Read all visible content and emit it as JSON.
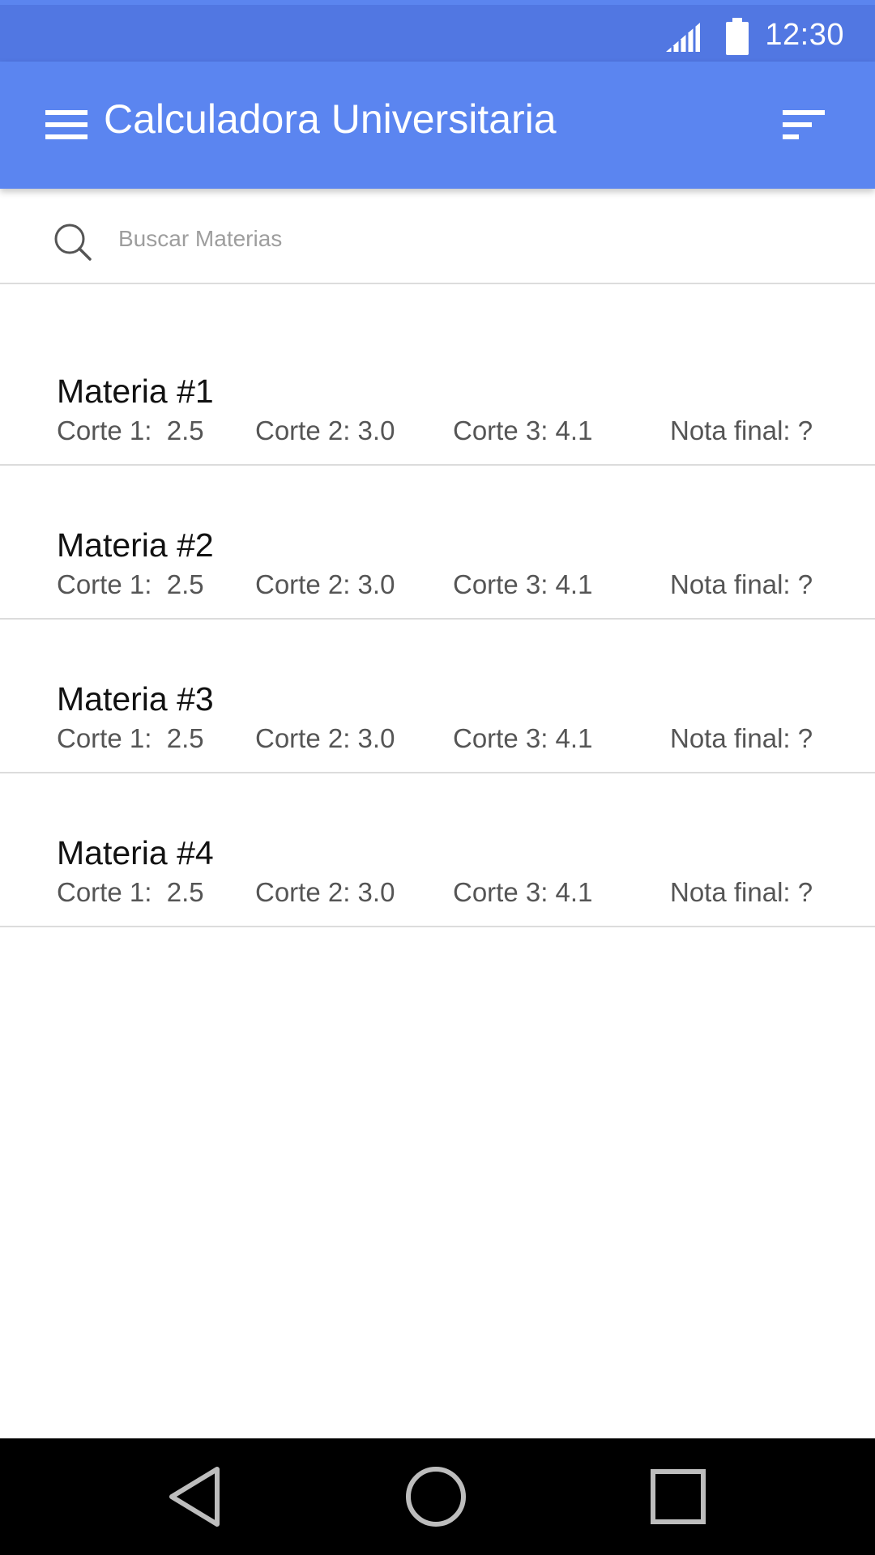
{
  "status_bar": {
    "time": "12:30",
    "icons": [
      "signal-icon",
      "battery-icon"
    ]
  },
  "app_bar": {
    "title": "Calculadora Universitaria",
    "left_icon": "menu-icon",
    "right_icon": "sort-icon",
    "color": "#5b85f0"
  },
  "search": {
    "placeholder": "Buscar Materias",
    "value": "",
    "icon": "search-icon"
  },
  "subjects": [
    {
      "name": "Materia #1",
      "c1": "Corte 1:  2.5",
      "c2": "Corte 2: 3.0",
      "c3": "Corte 3: 4.1",
      "final": "Nota final: ?"
    },
    {
      "name": "Materia #2",
      "c1": "Corte 1:  2.5",
      "c2": "Corte 2: 3.0",
      "c3": "Corte 3: 4.1",
      "final": "Nota final: ?"
    },
    {
      "name": "Materia #3",
      "c1": "Corte 1:  2.5",
      "c2": "Corte 2: 3.0",
      "c3": "Corte 3: 4.1",
      "final": "Nota final: ?"
    },
    {
      "name": "Materia #4",
      "c1": "Corte 1:  2.5",
      "c2": "Corte 2: 3.0",
      "c3": "Corte 3: 4.1",
      "final": "Nota final: ?"
    }
  ],
  "nav_bar": {
    "icons": [
      "back-icon",
      "home-icon",
      "recent-apps-icon"
    ]
  }
}
